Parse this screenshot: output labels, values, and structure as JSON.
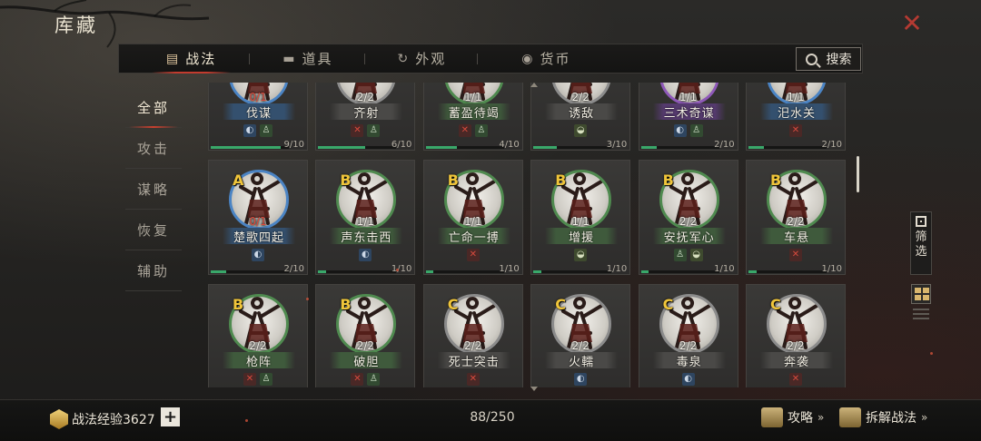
{
  "header": {
    "title": "库藏",
    "close_icon": "close-icon"
  },
  "tabs": [
    {
      "label": "战法",
      "icon": "scroll-icon",
      "active": true
    },
    {
      "label": "道具",
      "icon": "item-icon",
      "active": false
    },
    {
      "label": "外观",
      "icon": "swirl-icon",
      "active": false
    },
    {
      "label": "货币",
      "icon": "coin-icon",
      "active": false
    }
  ],
  "search": {
    "label": "搜索"
  },
  "categories": [
    {
      "label": "全部",
      "active": true
    },
    {
      "label": "攻击",
      "active": false
    },
    {
      "label": "谋略",
      "active": false
    },
    {
      "label": "恢复",
      "active": false
    },
    {
      "label": "辅助",
      "active": false
    }
  ],
  "cards": [
    {
      "grade": "",
      "count": "0/1",
      "count_red": true,
      "name": "伐谋",
      "color": "blue",
      "icons": [
        "mag",
        "figs"
      ],
      "progress": "9/10",
      "fill": 0.9
    },
    {
      "grade": "",
      "count": "2/2",
      "count_red": false,
      "name": "齐射",
      "color": "grey",
      "icons": [
        "cross",
        "figs"
      ],
      "progress": "6/10",
      "fill": 0.6
    },
    {
      "grade": "",
      "count": "1/1",
      "count_red": false,
      "name": "蓄盈待竭",
      "color": "green",
      "icons": [
        "cross",
        "figs"
      ],
      "progress": "4/10",
      "fill": 0.4
    },
    {
      "grade": "",
      "count": "2/2",
      "count_red": false,
      "name": "诱敌",
      "color": "grey",
      "icons": [
        "pot"
      ],
      "progress": "3/10",
      "fill": 0.3
    },
    {
      "grade": "",
      "count": "1/1",
      "count_red": false,
      "name": "三术奇谋",
      "color": "purple",
      "icons": [
        "mag",
        "figs"
      ],
      "progress": "2/10",
      "fill": 0.2
    },
    {
      "grade": "",
      "count": "1/1",
      "count_red": false,
      "name": "汜水关",
      "color": "blue",
      "icons": [
        "cross"
      ],
      "progress": "2/10",
      "fill": 0.2
    },
    {
      "grade": "A",
      "count": "0/1",
      "count_red": true,
      "name": "楚歌四起",
      "color": "blue",
      "icons": [
        "mag"
      ],
      "progress": "2/10",
      "fill": 0.2
    },
    {
      "grade": "B",
      "count": "1/1",
      "count_red": false,
      "name": "声东击西",
      "color": "green",
      "icons": [
        "mag"
      ],
      "progress": "1/10",
      "fill": 0.1
    },
    {
      "grade": "B",
      "count": "1/1",
      "count_red": false,
      "name": "亡命一搏",
      "color": "green",
      "icons": [
        "cross"
      ],
      "progress": "1/10",
      "fill": 0.1
    },
    {
      "grade": "B",
      "count": "1/1",
      "count_red": false,
      "name": "增援",
      "color": "green",
      "icons": [
        "pot"
      ],
      "progress": "1/10",
      "fill": 0.1
    },
    {
      "grade": "B",
      "count": "2/2",
      "count_red": false,
      "name": "安抚军心",
      "color": "green",
      "icons": [
        "figs",
        "pot"
      ],
      "progress": "1/10",
      "fill": 0.1
    },
    {
      "grade": "B",
      "count": "2/2",
      "count_red": false,
      "name": "车悬",
      "color": "green",
      "icons": [
        "cross"
      ],
      "progress": "1/10",
      "fill": 0.1
    },
    {
      "grade": "B",
      "count": "2/2",
      "count_red": false,
      "name": "枪阵",
      "color": "green",
      "icons": [
        "cross",
        "figs"
      ],
      "progress": "",
      "fill": 0
    },
    {
      "grade": "B",
      "count": "2/2",
      "count_red": false,
      "name": "破胆",
      "color": "green",
      "icons": [
        "cross",
        "figs"
      ],
      "progress": "",
      "fill": 0
    },
    {
      "grade": "C",
      "count": "2/2",
      "count_red": false,
      "name": "死士突击",
      "color": "grey",
      "icons": [
        "cross"
      ],
      "progress": "",
      "fill": 0
    },
    {
      "grade": "C",
      "count": "2/2",
      "count_red": false,
      "name": "火轜",
      "color": "grey",
      "icons": [
        "mag"
      ],
      "progress": "",
      "fill": 0
    },
    {
      "grade": "C",
      "count": "2/2",
      "count_red": false,
      "name": "毒泉",
      "color": "grey",
      "icons": [
        "mag"
      ],
      "progress": "",
      "fill": 0
    },
    {
      "grade": "C",
      "count": "2/2",
      "count_red": false,
      "name": "奔袭",
      "color": "grey",
      "icons": [
        "cross"
      ],
      "progress": "",
      "fill": 0
    }
  ],
  "side": {
    "filter_label_1": "筛",
    "filter_label_2": "选"
  },
  "footer": {
    "exp_label": "战法经验3627",
    "plus_label": "+",
    "capacity": "88/250",
    "guide_label": "攻略",
    "guide_arrow": "»",
    "dismantle_label": "拆解战法",
    "dismantle_arrow": "»"
  },
  "colors": {
    "accent_red": "#c23b2e",
    "grade_gold": "#f0c53a",
    "progress_green": "#39a86a",
    "ring_green": "#4f8a4f",
    "ring_blue": "#4b84c4",
    "ring_purple": "#8e58b8",
    "ring_grey": "#8b8b8b"
  }
}
